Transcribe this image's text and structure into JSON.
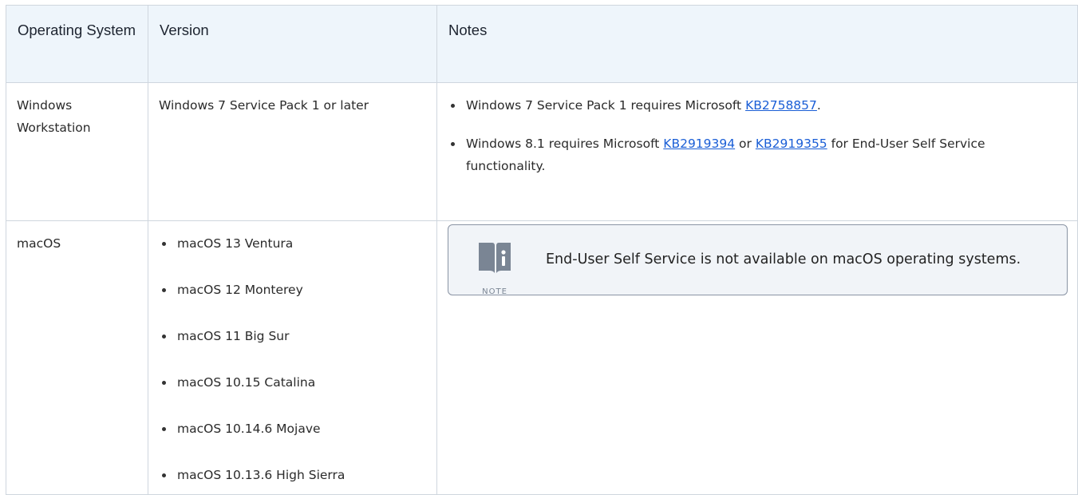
{
  "table": {
    "headers": {
      "os": "Operating System",
      "version": "Version",
      "notes": "Notes"
    },
    "rows": [
      {
        "os": "Windows Workstation",
        "version": "Windows 7 Service Pack 1 or later",
        "notes": [
          {
            "before": "Windows 7 Service Pack 1 requires Microsoft ",
            "link1": "KB2758857",
            "after": "."
          },
          {
            "before": "Windows 8.1 requires Microsoft ",
            "link1": "KB2919394",
            "mid": " or ",
            "link2": "KB2919355",
            "after": " for End-User Self Service functionality."
          }
        ]
      },
      {
        "os": "macOS",
        "versions": [
          "macOS 13 Ventura",
          "macOS 12 Monterey",
          "macOS 11 Big Sur",
          "macOS 10.15 Catalina",
          "macOS 10.14.6 Mojave",
          "macOS 10.13.6 High Sierra"
        ],
        "note_box": {
          "label": "NOTE",
          "icon": "note-book-icon",
          "text": "End-User Self Service is not available on macOS operating systems."
        }
      }
    ]
  },
  "colors": {
    "header_bg": "#eef5fb",
    "border": "#cfd6de",
    "link": "#1a5ed6",
    "note_bg": "#f1f4f8",
    "note_border": "#8a94a4",
    "icon": "#7a8594"
  }
}
